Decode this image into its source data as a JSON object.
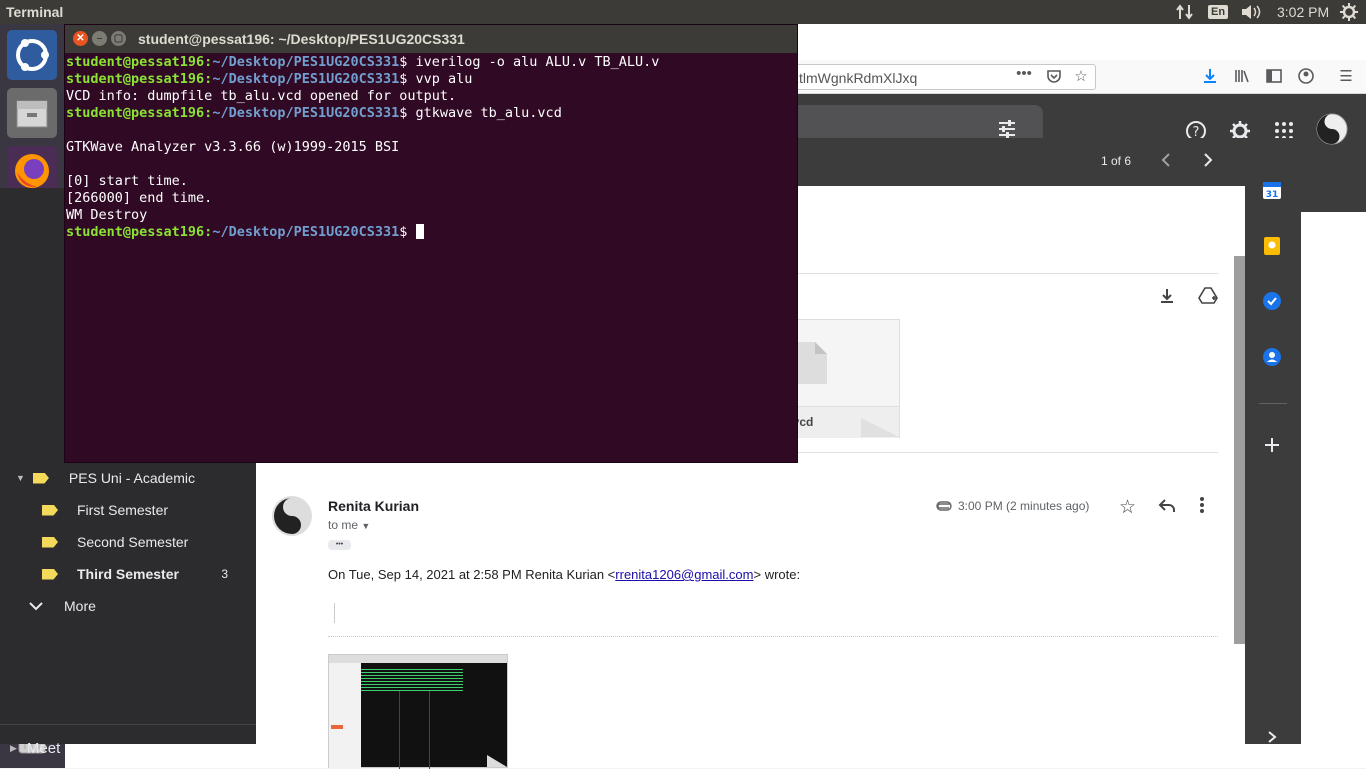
{
  "top_panel": {
    "app_name": "Terminal",
    "lang": "En",
    "time": "3:02 PM"
  },
  "launcher": {
    "items": [
      "ubuntu-dash-icon",
      "files-icon",
      "firefox-icon",
      "writer-icon",
      "calc-icon",
      "impress-icon",
      "software-center-icon",
      "amazon-icon",
      "system-settings-icon",
      "text-editor-icon",
      "terminal-icon",
      "trash-icon"
    ]
  },
  "browser": {
    "url_fragment": "ztlmWgnkRdmXlJxq",
    "pagination": "1 of 6"
  },
  "gmail_nav": {
    "labels": [
      {
        "name": "PES Uni - Academic",
        "count": ""
      },
      {
        "name": "First Semester",
        "count": ""
      },
      {
        "name": "Second Semester",
        "count": ""
      },
      {
        "name": "Third Semester",
        "count": "3"
      }
    ],
    "more": "More",
    "meet": "Meet"
  },
  "email": {
    "attachment_name": "tb_alu.vcd",
    "sender": "Renita Kurian",
    "to": "to me",
    "time": "3:00 PM (2 minutes ago)",
    "quote_prefix": "On Tue, Sep 14, 2021 at 2:58 PM Renita Kurian <",
    "quote_email": "rrenita1206@gmail.com",
    "quote_suffix": "> wrote:",
    "ellipsis": "•••"
  },
  "terminal": {
    "title": "student@pessat196: ~/Desktop/PES1UG20CS331",
    "user_host": "student@pessat196",
    "path": "~/Desktop/PES1UG20CS331",
    "lines": [
      {
        "kind": "prompt",
        "cmd": " iverilog -o alu ALU.v TB_ALU.v"
      },
      {
        "kind": "prompt",
        "cmd": " vvp alu"
      },
      {
        "kind": "out",
        "text": "VCD info: dumpfile tb_alu.vcd opened for output."
      },
      {
        "kind": "prompt",
        "cmd": " gtkwave tb_alu.vcd"
      },
      {
        "kind": "out",
        "text": ""
      },
      {
        "kind": "out",
        "text": "GTKWave Analyzer v3.3.66 (w)1999-2015 BSI"
      },
      {
        "kind": "out",
        "text": ""
      },
      {
        "kind": "out",
        "text": "[0] start time."
      },
      {
        "kind": "out",
        "text": "[266000] end time."
      },
      {
        "kind": "out",
        "text": "WM Destroy"
      },
      {
        "kind": "prompt",
        "cmd": " ",
        "cursor": true
      }
    ]
  },
  "colors": {
    "terminal_bg": "#300a24",
    "prompt_green": "#8ae234",
    "prompt_blue": "#729fcf",
    "label_yellow": "#f5d95a"
  }
}
